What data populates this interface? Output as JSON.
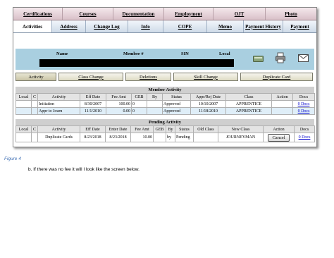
{
  "nav_primary": [
    "Certifications",
    "Courses",
    "Documentation",
    "Employment",
    "OJT",
    "Photo"
  ],
  "nav_secondary": [
    "Activities",
    "Address",
    "Change Log",
    "Info",
    "COPE",
    "Memo",
    "Payment History",
    "Payment"
  ],
  "member_header": {
    "name": "Name",
    "member_no": "Member #",
    "sin": "SIN",
    "local": "Local"
  },
  "sub_tabs": [
    "Activity",
    "Class Change",
    "Deletions",
    "Skill Change",
    "Duplicate Card"
  ],
  "member_activity": {
    "title": "Member Activity",
    "columns": [
      "Local",
      "C",
      "Activity",
      "Eff Date",
      "Fee Amt",
      "GEB",
      "By",
      "Status",
      "Appr/Rej Date",
      "Class",
      "Action",
      "Docs"
    ],
    "rows": [
      {
        "local": "",
        "c": "",
        "activity": "Initiation",
        "eff_date": "8/30/2007",
        "fee_amt": "100.00",
        "geb": "0",
        "by": "",
        "status": "Approved",
        "appr_date": "10/10/2007",
        "class": "APPRENTICE",
        "action": "",
        "docs": "0 Docs"
      },
      {
        "local": "",
        "c": "",
        "activity": "Appr to Journ",
        "eff_date": "11/1/2010",
        "fee_amt": "0.00",
        "geb": "0",
        "by": "",
        "status": "Approved",
        "appr_date": "11/18/2010",
        "class": "APPRENTICE",
        "action": "",
        "docs": "0 Docs"
      }
    ]
  },
  "pending_activity": {
    "title": "Pending Activity",
    "columns": [
      "Local",
      "C",
      "Activity",
      "Eff Date",
      "Enter Date",
      "Fee Amt",
      "GEB",
      "By",
      "Status",
      "Old Class",
      "New Class",
      "Action",
      "Docs"
    ],
    "rows": [
      {
        "local": "",
        "c": "",
        "activity": "Duplicate Cards",
        "eff_date": "8/23/2018",
        "enter_date": "8/23/2018",
        "fee_amt": "10.00",
        "geb": "",
        "by": "by",
        "status": "Pending",
        "old_class": "",
        "new_class": "JOURNEYMAN",
        "action": "Cancel",
        "docs": "0 Docs"
      }
    ]
  },
  "caption": "Figure 4",
  "note": "b.   If there was no fee it will I look like the screen below."
}
